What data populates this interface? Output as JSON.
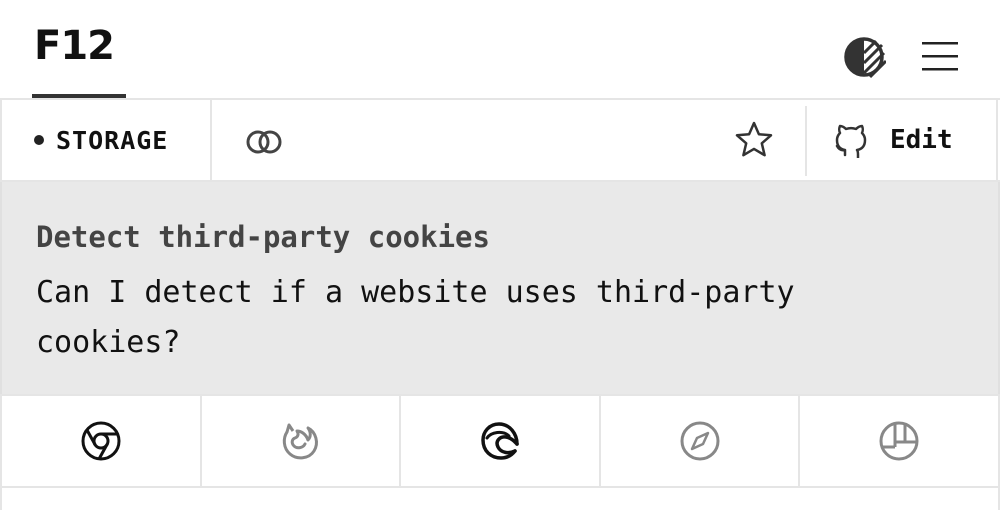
{
  "header": {
    "logo": "F12",
    "icons": {
      "theme": "theme-toggle-icon",
      "menu": "hamburger-menu-icon"
    }
  },
  "toolbar": {
    "category_label": "STORAGE",
    "edit_label": "Edit",
    "icons": {
      "share": "link-icon",
      "favorite": "star-icon",
      "source": "github-icon"
    }
  },
  "content": {
    "title": "Detect third-party cookies",
    "description": "Can I detect if a website uses third-party cookies?"
  },
  "browsers": {
    "items": [
      {
        "name": "chrome",
        "icon": "chrome-icon",
        "color": "#111111"
      },
      {
        "name": "firefox",
        "icon": "firefox-icon",
        "color": "#888888"
      },
      {
        "name": "edge",
        "icon": "edge-icon",
        "color": "#111111"
      },
      {
        "name": "safari",
        "icon": "safari-icon",
        "color": "#888888"
      },
      {
        "name": "other",
        "icon": "other-browser-icon",
        "color": "#888888"
      }
    ]
  }
}
